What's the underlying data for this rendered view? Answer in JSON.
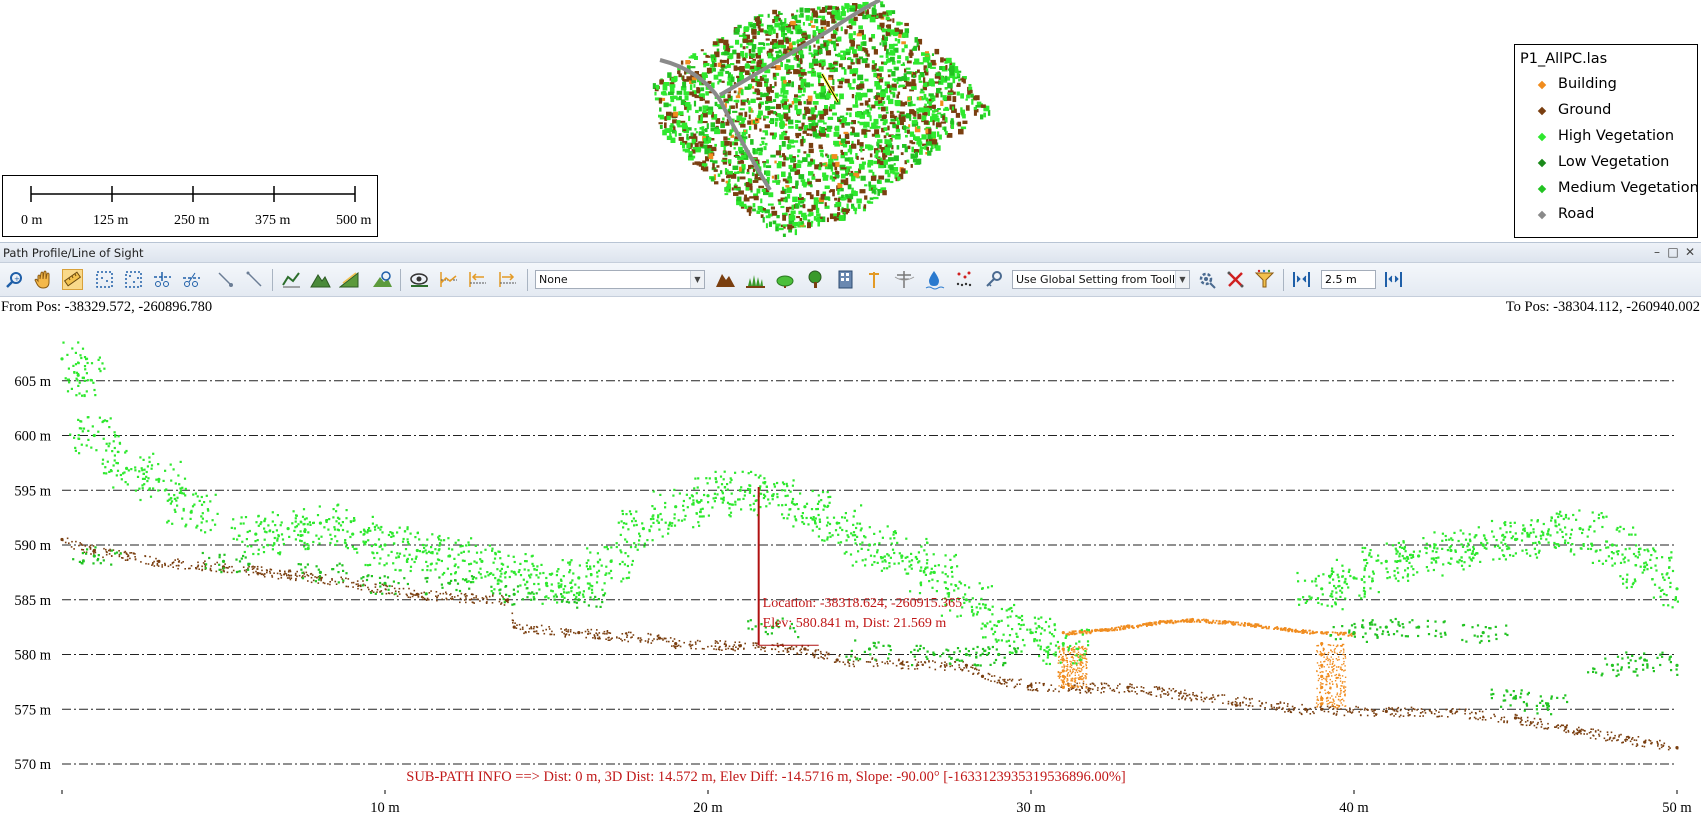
{
  "map": {
    "scale_bar": {
      "labels": [
        "0 m",
        "125 m",
        "250 m",
        "375 m",
        "500 m"
      ]
    },
    "legend": {
      "title": "P1_AllPC.las",
      "items": [
        {
          "label": "Building",
          "color": "#f08c1e"
        },
        {
          "label": "Ground",
          "color": "#7a3f10"
        },
        {
          "label": "High Vegetation",
          "color": "#2ee82e"
        },
        {
          "label": "Low Vegetation",
          "color": "#1a8a1a"
        },
        {
          "label": "Medium Vegetation",
          "color": "#22c322"
        },
        {
          "label": "Road",
          "color": "#8a8a8a"
        }
      ]
    }
  },
  "panel": {
    "title": "Path Profile/Line of Sight",
    "window_buttons": {
      "minimize": "–",
      "maximize": "□",
      "close": "✕"
    }
  },
  "toolbar": {
    "left_tools": [
      "zoom-icon",
      "pan-hand-icon",
      "measure-ruler-icon",
      "select-box-icon",
      "select-points-icon",
      "slice-icon",
      "cut-icon",
      "pointer-icon",
      "line-tool-icon"
    ],
    "terrain_tools": [
      "profile-line-icon",
      "terrain-icon",
      "slope-icon",
      "terrain-search-icon"
    ],
    "view_tools": [
      "line-of-sight-icon",
      "profile-chart-icon",
      "step-back-icon",
      "step-forward-icon"
    ],
    "class_dropdown": {
      "value": "None"
    },
    "class_tools": [
      "mountain-icon",
      "grass-icon",
      "shrub-icon",
      "tree-icon",
      "building-icon",
      "pole-icon",
      "powerline-icon",
      "water-icon",
      "noise-points-icon",
      "key-icon"
    ],
    "setting_dropdown": {
      "value": "Use Global Setting from Toolb"
    },
    "right_tools": [
      "settings-tools-icon",
      "clear-icon",
      "filter-icon"
    ],
    "width_input": {
      "value": "2.5 m"
    }
  },
  "profile": {
    "from_pos": "From Pos: -38329.572, -260896.780",
    "to_pos": "To Pos: -38304.112, -260940.002",
    "cursor": {
      "location": "Location: -38318.624, -260915.365",
      "elevation": "Elev: 580.841 m, Dist: 21.569 m",
      "dist": 21.569,
      "elev": 580.841
    },
    "subpath_info": "SUB-PATH INFO ==> Dist: 0 m, 3D Dist: 14.572 m, Elev Diff: -14.5716 m, Slope: -90.00° [-1633123935319536896.00%]"
  },
  "chart_data": {
    "type": "scatter",
    "title": "",
    "xlabel": "",
    "ylabel": "",
    "xlim": [
      0,
      50
    ],
    "ylim": [
      569,
      608
    ],
    "x_ticks": [
      10,
      20,
      30,
      40,
      50
    ],
    "x_tick_labels": [
      "10 m",
      "20 m",
      "30 m",
      "40 m",
      "50 m"
    ],
    "y_ticks": [
      570,
      575,
      580,
      585,
      590,
      595,
      600,
      605
    ],
    "y_tick_labels": [
      "570 m",
      "575 m",
      "580 m",
      "585 m",
      "590 m",
      "595 m",
      "600 m",
      "605 m"
    ],
    "grid": "horizontal dash-dot",
    "series": [
      {
        "name": "Ground",
        "color": "#7a3f10",
        "x": [
          0,
          1,
          3,
          5,
          8,
          11,
          13.8,
          14,
          16,
          18.5,
          19,
          21,
          23,
          24,
          26,
          28,
          28.5,
          30,
          31.3,
          33,
          38.5,
          39,
          41,
          43,
          45,
          47,
          49,
          50
        ],
        "y": [
          590.5,
          589.5,
          588.5,
          588,
          587,
          585.5,
          585,
          582.5,
          582,
          581.5,
          581,
          580.8,
          580.5,
          579.5,
          579.2,
          579,
          578,
          577.2,
          577,
          577,
          575,
          575,
          574.8,
          574.8,
          574.2,
          573,
          572,
          571.5
        ]
      },
      {
        "name": "Building",
        "color": "#f08c1e",
        "x": [
          31,
          32,
          33,
          34,
          35,
          36,
          37,
          38,
          39,
          40,
          31,
          31,
          31,
          31,
          31,
          31,
          39,
          39,
          39,
          39,
          39,
          39,
          39
        ],
        "y": [
          582,
          582.2,
          582.6,
          583,
          583.2,
          583,
          582.7,
          582.3,
          582,
          581.9,
          580.5,
          579.5,
          578.5,
          578,
          577.5,
          577,
          581,
          580,
          579,
          578,
          577,
          576,
          575.5
        ]
      },
      {
        "name": "High Vegetation",
        "color": "#2ee82e",
        "x": [
          0,
          0.5,
          1,
          2,
          3,
          4,
          6,
          7,
          8,
          9,
          10,
          11,
          12,
          13,
          14,
          15,
          16,
          17,
          18,
          19,
          20,
          21,
          22,
          23,
          24,
          25,
          26,
          27,
          28,
          29,
          30,
          31,
          39,
          40,
          41,
          42,
          43,
          44,
          45,
          46,
          47,
          48,
          49,
          50
        ],
        "y": [
          607,
          605.5,
          600,
          597,
          596,
          593,
          591,
          591.5,
          592,
          591,
          590,
          589.5,
          589,
          588.5,
          587.5,
          586.5,
          587,
          588.5,
          591.5,
          593.5,
          594.5,
          595,
          594.5,
          593.5,
          592,
          590,
          589,
          587.5,
          585,
          583,
          582,
          581,
          586,
          587,
          588.5,
          589,
          589.5,
          590,
          590.5,
          591,
          591.5,
          590,
          588,
          586
        ]
      },
      {
        "name": "Medium Vegetation",
        "color": "#22c322",
        "x": [
          1,
          5,
          8,
          10,
          12,
          14,
          16,
          22,
          25,
          27,
          28,
          29,
          40,
          41,
          42,
          44,
          45,
          46,
          48,
          49,
          50
        ],
        "y": [
          589,
          588.5,
          587.5,
          586.5,
          586.5,
          585.5,
          585,
          582.5,
          580.5,
          580,
          580,
          580,
          582,
          582.5,
          582.5,
          582,
          576,
          575.5,
          579,
          579.5,
          579
        ]
      }
    ]
  }
}
